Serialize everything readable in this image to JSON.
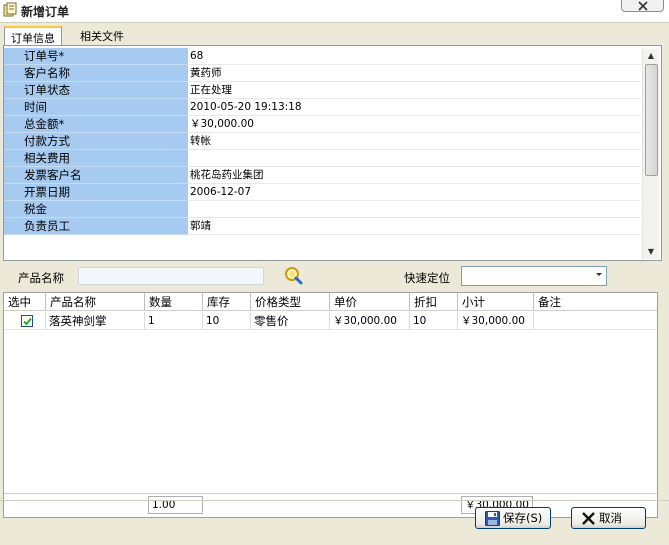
{
  "window": {
    "title": "新增订单"
  },
  "tabs": [
    {
      "label": "订单信息",
      "active": true
    },
    {
      "label": "相关文件",
      "active": false
    }
  ],
  "order_fields": [
    {
      "label": "订单号*",
      "value": "68"
    },
    {
      "label": "客户名称",
      "value": "黄药师"
    },
    {
      "label": "订单状态",
      "value": "正在处理"
    },
    {
      "label": "时间",
      "value": "2010-05-20 19:13:18"
    },
    {
      "label": "总金额*",
      "value": "￥30,000.00"
    },
    {
      "label": "付款方式",
      "value": "转帐"
    },
    {
      "label": "相关费用",
      "value": ""
    },
    {
      "label": "发票客户名",
      "value": "桃花岛药业集团"
    },
    {
      "label": "开票日期",
      "value": "2006-12-07"
    },
    {
      "label": "税金",
      "value": ""
    },
    {
      "label": "负责员工",
      "value": "郭靖"
    }
  ],
  "search": {
    "product_label": "产品名称",
    "product_value": "",
    "quick_label": "快速定位",
    "quick_value": ""
  },
  "table": {
    "columns": [
      "选中",
      "产品名称",
      "数量",
      "库存",
      "价格类型",
      "单价",
      "折扣",
      "小计",
      "备注"
    ],
    "rows": [
      {
        "checked": true,
        "product": "落英神剑掌",
        "qty": "1",
        "stock": "10",
        "price_type": "零售价",
        "unit_price": "￥30,000.00",
        "discount": "10",
        "subtotal": "￥30,000.00",
        "note": ""
      }
    ],
    "footer": {
      "qty_total": "1.00",
      "subtotal_total": "￥30,000.00"
    }
  },
  "buttons": {
    "save": "保存(S)",
    "cancel": "取消"
  },
  "icons": {
    "app": "document-app-icon",
    "close": "close-icon",
    "search": "search-icon",
    "save": "floppy-disk-icon",
    "cancel": "x-icon"
  },
  "colors": {
    "label_bg": "#a6caf0",
    "tab_accent": "#ffc73c",
    "window_bg": "#ece9d8"
  }
}
